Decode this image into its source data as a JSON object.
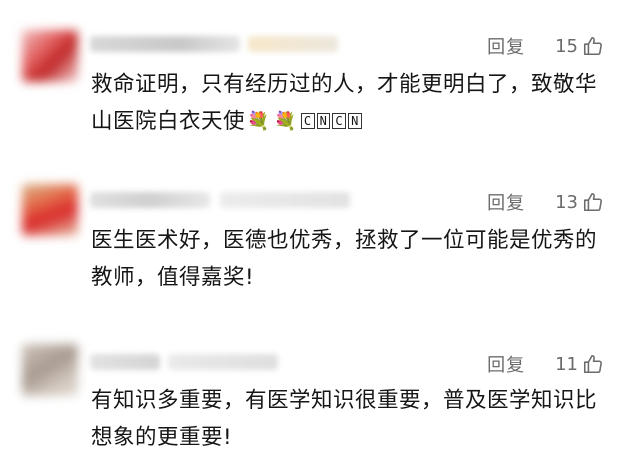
{
  "comments": [
    {
      "reply_label": "回复",
      "like_count": "15",
      "text": "救命证明，只有经历过的人，才能更明白了，致敬华山医院白衣天使",
      "emojis": [
        "flower-bouquet-icon",
        "flower-bouquet-icon"
      ],
      "badges": [
        "C",
        "N",
        "C",
        "N"
      ]
    },
    {
      "reply_label": "回复",
      "like_count": "13",
      "text": "医生医术好，医德也优秀，拯救了一位可能是优秀的教师，值得嘉奖!"
    },
    {
      "reply_label": "回复",
      "like_count": "11",
      "text": "有知识多重要，有医学知识很重要，普及医学知识比想象的更重要!"
    }
  ],
  "colors": {
    "text": "#161616",
    "meta": "#6b6b6b",
    "background": "#ffffff"
  }
}
